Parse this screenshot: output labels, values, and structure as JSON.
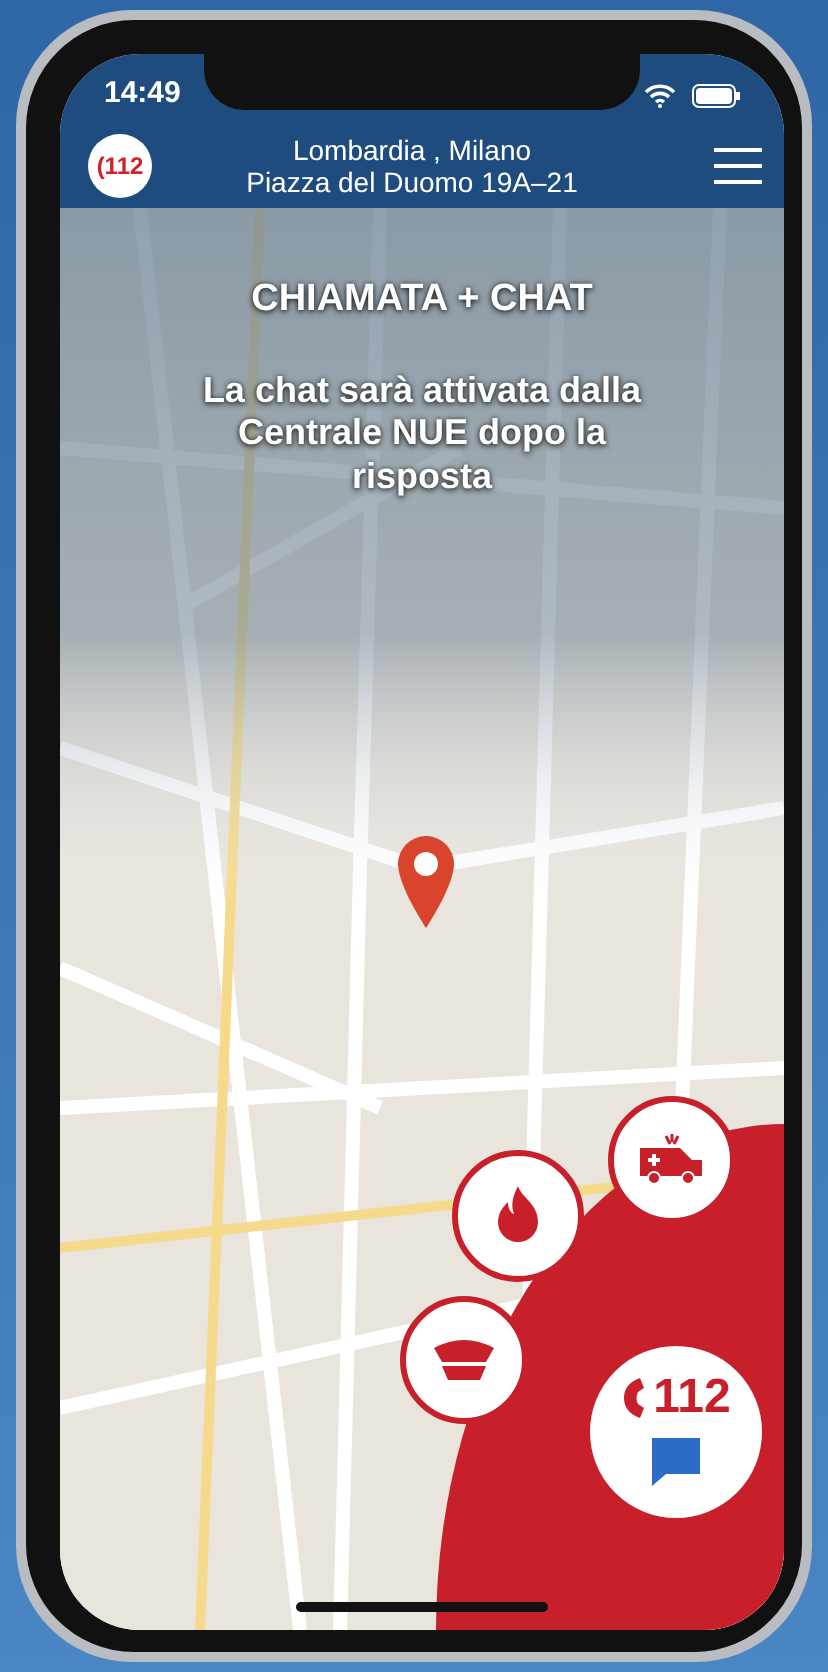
{
  "status_bar": {
    "time": "14:49"
  },
  "header": {
    "logo": "(112",
    "region": "Lombardia , Milano",
    "address": "Piazza del Duomo 19A–21"
  },
  "banner": {
    "title": "CHIAMATA + CHAT",
    "message": "La chat sarà attivata dalla Centrale NUE dopo la risposta"
  },
  "emergency_buttons": [
    {
      "kind": "fire"
    },
    {
      "kind": "ambulance"
    },
    {
      "kind": "police"
    },
    {
      "kind": "call",
      "label": "112"
    }
  ]
}
